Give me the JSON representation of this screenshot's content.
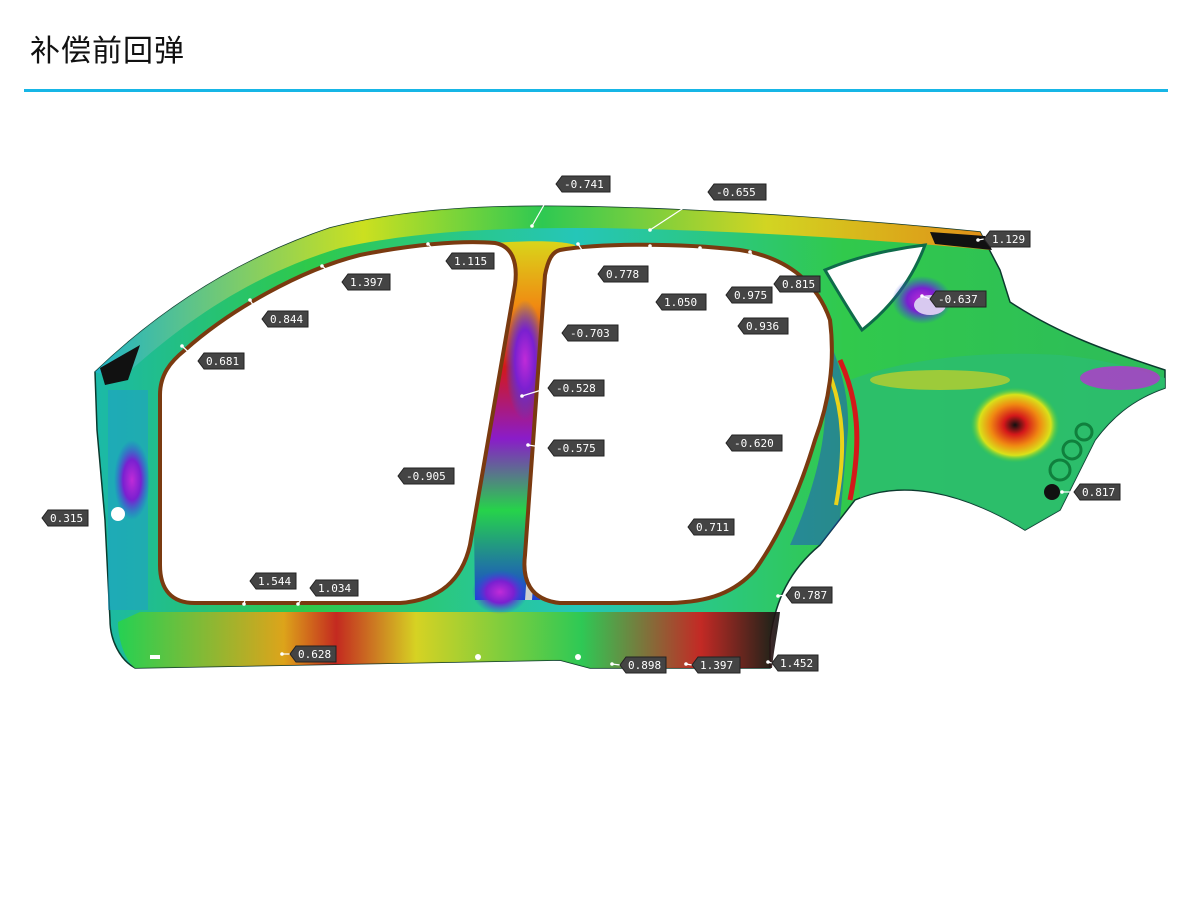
{
  "page": {
    "title": "补偿前回弹",
    "accent_color": "#17b6e6"
  },
  "figure": {
    "subject": "body-side panel springback deviation color map",
    "palette": [
      "#8a1cc9",
      "#1c3fd6",
      "#10c4c0",
      "#26d34a",
      "#d9e21a",
      "#f08a12",
      "#d4181a",
      "#101010"
    ],
    "annotations": [
      {
        "id": "a1",
        "value": "-0.741"
      },
      {
        "id": "a2",
        "value": "-0.655"
      },
      {
        "id": "a3",
        "value": "1.129"
      },
      {
        "id": "a4",
        "value": "1.115"
      },
      {
        "id": "a5",
        "value": "1.397"
      },
      {
        "id": "a6",
        "value": "0.778"
      },
      {
        "id": "a7",
        "value": "1.050"
      },
      {
        "id": "a8",
        "value": "0.975"
      },
      {
        "id": "a9",
        "value": "0.815"
      },
      {
        "id": "a10",
        "value": "-0.637"
      },
      {
        "id": "a11",
        "value": "0.844"
      },
      {
        "id": "a12",
        "value": "0.936"
      },
      {
        "id": "a13",
        "value": "-0.703"
      },
      {
        "id": "a14",
        "value": "0.681"
      },
      {
        "id": "a15",
        "value": "-0.528"
      },
      {
        "id": "a16",
        "value": "-0.575"
      },
      {
        "id": "a17",
        "value": "-0.620"
      },
      {
        "id": "a18",
        "value": "-0.905"
      },
      {
        "id": "a19",
        "value": "0.315"
      },
      {
        "id": "a20",
        "value": "0.817"
      },
      {
        "id": "a21",
        "value": "0.711"
      },
      {
        "id": "a22",
        "value": "1.544"
      },
      {
        "id": "a23",
        "value": "1.034"
      },
      {
        "id": "a24",
        "value": "0.787"
      },
      {
        "id": "a25",
        "value": "0.628"
      },
      {
        "id": "a26",
        "value": "0.898"
      },
      {
        "id": "a27",
        "value": "1.397"
      },
      {
        "id": "a28",
        "value": "1.452"
      }
    ]
  }
}
